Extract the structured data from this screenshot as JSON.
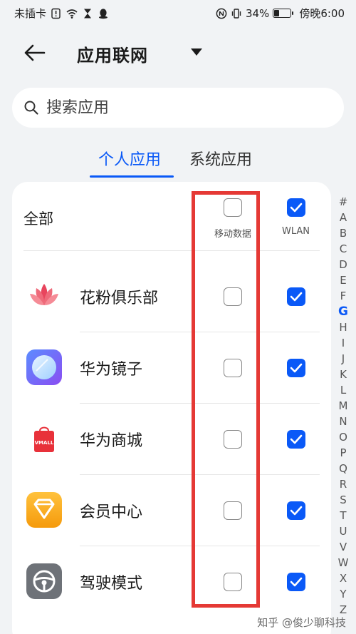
{
  "status_bar": {
    "left_text": "未插卡",
    "battery": "34%",
    "battery_level": 0.34,
    "time": "傍晚6:00"
  },
  "header": {
    "title": "应用联网"
  },
  "search": {
    "placeholder": "搜索应用"
  },
  "tabs": [
    {
      "label": "个人应用",
      "active": true
    },
    {
      "label": "系统应用",
      "active": false
    }
  ],
  "list_header": {
    "all_label": "全部",
    "mobile_data_label": "移动数据",
    "wlan_label": "WLAN",
    "mobile_data_checked": false,
    "wlan_checked": true
  },
  "apps": [
    {
      "name": "花粉俱乐部",
      "icon": "lotus-icon",
      "mobile_data": false,
      "wlan": true
    },
    {
      "name": "华为镜子",
      "icon": "mirror-icon",
      "mobile_data": false,
      "wlan": true
    },
    {
      "name": "华为商城",
      "icon": "vmall-icon",
      "icon_text": "VMALL",
      "mobile_data": false,
      "wlan": true
    },
    {
      "name": "会员中心",
      "icon": "member-center-icon",
      "mobile_data": false,
      "wlan": true
    },
    {
      "name": "驾驶模式",
      "icon": "steering-wheel-icon",
      "mobile_data": false,
      "wlan": true
    }
  ],
  "alphabet_index": [
    "#",
    "A",
    "B",
    "C",
    "D",
    "E",
    "F",
    "G",
    "H",
    "I",
    "J",
    "K",
    "L",
    "M",
    "N",
    "O",
    "P",
    "Q",
    "R",
    "S",
    "T",
    "U",
    "V",
    "W",
    "X",
    "Y",
    "Z"
  ],
  "alphabet_active": "G",
  "watermark": "知乎 @俊少聊科技",
  "colors": {
    "accent": "#0a59f7",
    "highlight": "#e53935",
    "background": "#f1f3f5"
  }
}
